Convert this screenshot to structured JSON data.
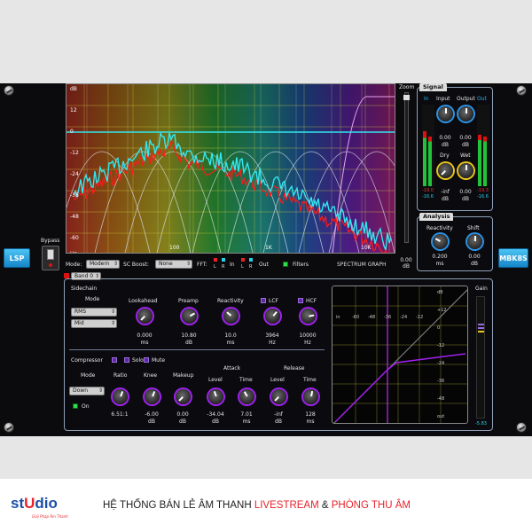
{
  "plugin": {
    "name_left": "LSP",
    "name_right": "MBK8S",
    "bypass_label": "Bypass"
  },
  "graph": {
    "y_ticks": [
      "dB",
      "12",
      "0",
      "-12",
      "-24",
      "-36",
      "-48",
      "-60",
      "Hz"
    ],
    "x_ticks": [
      "100",
      "1K",
      "10K"
    ],
    "zoom_label": "Zoom",
    "zoom_value": "0.00",
    "zoom_unit": "dB",
    "title": "SPECTRUM GRAPH",
    "mode_label": "Mode:",
    "mode_value": "Modern",
    "scboost_label": "SC Boost:",
    "scboost_value": "None",
    "fft_label": "FFT:",
    "fft_in_label": "In",
    "fft_out_label": "Out",
    "lr_l": "L",
    "lr_r": "R",
    "filters_label": "Filters"
  },
  "signal": {
    "tab": "Signal",
    "in_label": "In",
    "input_label": "Input",
    "output_label": "Output",
    "out_label": "Out",
    "input_value": "0.00",
    "output_value": "0.00",
    "unit": "dB",
    "dry_label": "Dry",
    "wet_label": "Wet",
    "dry_value": "-inf",
    "wet_value": "0.00",
    "meter_in_a": "-19.0",
    "meter_in_b": "-16.6",
    "meter_out_a": "-19.3",
    "meter_out_b": "-16.6"
  },
  "analysis": {
    "tab": "Analysis",
    "reactivity_label": "Reactivity",
    "shift_label": "Shift",
    "reactivity_value": "0.200",
    "reactivity_unit": "ms",
    "shift_value": "0.00",
    "shift_unit": "dB"
  },
  "band": {
    "tab": "Band 0",
    "sidechain_label": "Sidechain",
    "mode_label": "Mode",
    "sc_mode": "RMS",
    "sc_source": "Mid",
    "lookahead_label": "Lookahead",
    "lookahead_value": "0.000",
    "lookahead_unit": "ms",
    "preamp_label": "Preamp",
    "preamp_value": "10.80",
    "preamp_unit": "dB",
    "reactivity_label": "Reactivity",
    "reactivity_value": "10.0",
    "reactivity_unit": "ms",
    "lcf_label": "LCF",
    "lcf_value": "3964",
    "lcf_unit": "Hz",
    "hcf_label": "HCF",
    "hcf_value": "10000",
    "hcf_unit": "Hz",
    "compressor_label": "Compressor",
    "solo_label": "Solo",
    "mute_label": "Mute",
    "comp_mode_label": "Mode",
    "comp_mode_value": "Down",
    "on_label": "On",
    "ratio_label": "Ratio",
    "ratio_value": "6.51:1",
    "knee_label": "Knee",
    "knee_value": "-6.00",
    "knee_unit": "dB",
    "makeup_label": "Makeup",
    "makeup_value": "0.00",
    "makeup_unit": "dB",
    "attack_label": "Attack",
    "release_label": "Release",
    "level_label": "Level",
    "time_label": "Time",
    "attack_level_value": "-34.04",
    "attack_level_unit": "dB",
    "attack_time_value": "7.01",
    "attack_time_unit": "ms",
    "release_level_value": "-inf",
    "release_level_unit": "dB",
    "release_time_value": "128",
    "release_time_unit": "ms"
  },
  "curve": {
    "x_ticks": [
      "in",
      "-60",
      "-48",
      "-36",
      "-24",
      "-12"
    ],
    "y_ticks": [
      "dB",
      "+12",
      "0",
      "-12",
      "-24",
      "-36",
      "-48",
      "out"
    ],
    "gain_label": "Gain",
    "gain_value": "-5.83"
  },
  "footer": {
    "logo_st": "st",
    "logo_r": "U",
    "logo_dio": "dio",
    "logo_tagline": "Giải Pháp Âm Thanh",
    "text_a": "HỆ THỐNG BÁN LẺ ÂM THANH ",
    "text_b": "LIVESTREAM",
    "text_c": " & ",
    "text_d": "PHÒNG THU ÂM"
  },
  "colors": {
    "accent_purple": "#a020f0",
    "accent_blue": "#2b93e6",
    "spectrum_cyan": "#33e6f0",
    "spectrum_red": "#ff1a1a",
    "footer_red": "#e8222a"
  }
}
